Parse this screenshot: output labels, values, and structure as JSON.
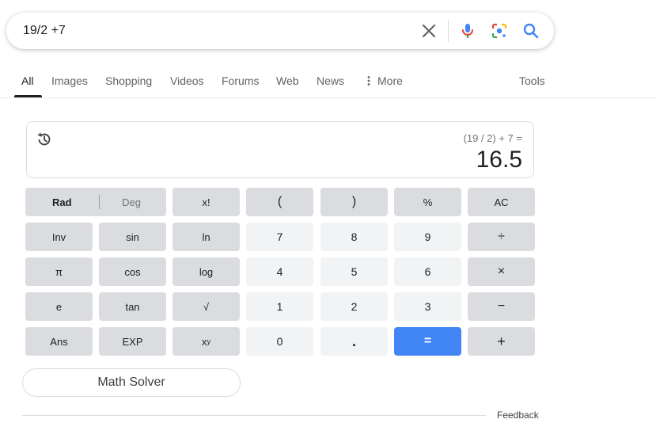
{
  "search": {
    "query": "19/2 +7"
  },
  "tabs": [
    {
      "label": "All"
    },
    {
      "label": "Images"
    },
    {
      "label": "Shopping"
    },
    {
      "label": "Videos"
    },
    {
      "label": "Forums"
    },
    {
      "label": "Web"
    },
    {
      "label": "News"
    },
    {
      "label": "More"
    },
    {
      "label": "Tools"
    }
  ],
  "calculator": {
    "expression": "(19 / 2) + 7 =",
    "result": "16.5",
    "keys": {
      "rad": "Rad",
      "deg": "Deg",
      "fact": "x!",
      "lparen": "(",
      "rparen": ")",
      "percent": "%",
      "ac": "AC",
      "inv": "Inv",
      "sin": "sin",
      "ln": "ln",
      "k7": "7",
      "k8": "8",
      "k9": "9",
      "divide": "÷",
      "pi": "π",
      "cos": "cos",
      "log": "log",
      "k4": "4",
      "k5": "5",
      "k6": "6",
      "multiply": "×",
      "e": "e",
      "tan": "tan",
      "sqrt": "√",
      "k1": "1",
      "k2": "2",
      "k3": "3",
      "minus": "−",
      "ans": "Ans",
      "exp": "EXP",
      "pow_base": "x",
      "pow_exp": "y",
      "k0": "0",
      "dot": ".",
      "equals": "=",
      "plus": "+"
    }
  },
  "math_solver": {
    "label": "Math Solver"
  },
  "feedback": {
    "label": "Feedback"
  },
  "colors": {
    "accent_blue": "#4285f4",
    "key_gray": "#dadce0",
    "key_light": "#f1f3f4"
  },
  "icons": {
    "clear": "close-icon",
    "voice": "microphone-icon",
    "lens": "camera-lens-icon",
    "search": "search-icon",
    "more": "more-vertical-icon",
    "history": "history-icon"
  }
}
